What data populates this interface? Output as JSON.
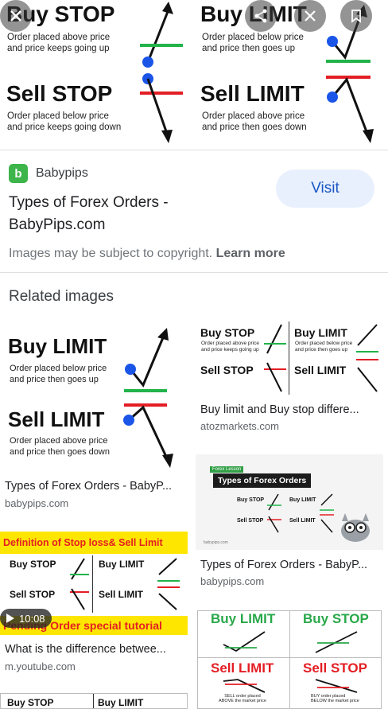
{
  "hero": {
    "left": {
      "top_title": "Buy STOP",
      "top_desc_1": "Order placed above price",
      "top_desc_2": "and price keeps going up",
      "bottom_title": "Sell STOP",
      "bottom_desc_1": "Order placed below price",
      "bottom_desc_2": "and price keeps going down"
    },
    "right": {
      "top_title": "Buy LIMIT",
      "top_desc_1": "Order placed below price",
      "top_desc_2": "and price then goes up",
      "bottom_title": "Sell LIMIT",
      "bottom_desc_1": "Order placed above price",
      "bottom_desc_2": "and price then goes down"
    },
    "buttons": {
      "close": "close-icon",
      "share": "share-icon",
      "save": "bookmark-icon"
    }
  },
  "source": {
    "favicon_letter": "b",
    "name": "Babypips",
    "title": "Types of Forex Orders - BabyPips.com",
    "visit_label": "Visit",
    "copyright_text": "Images may be subject to copyright.",
    "learn_more": "Learn more"
  },
  "related": {
    "heading": "Related images",
    "items": [
      {
        "caption": "Types of Forex Orders - BabyP...",
        "domain": "babypips.com",
        "thumb": {
          "t1": "Buy LIMIT",
          "d1a": "Order placed below price",
          "d1b": "and price then goes up",
          "t2": "Sell LIMIT",
          "d2a": "Order placed above price",
          "d2b": "and price then goes down"
        }
      },
      {
        "caption": "Buy limit and Buy stop differe...",
        "domain": "atozmarkets.com",
        "thumb": {
          "a": "Buy STOP",
          "b": "Buy LIMIT",
          "c": "Sell STOP",
          "d": "Sell LIMIT",
          "da": "Order placed above price",
          "db": "and price keeps going up",
          "dc": "Order placed below price",
          "dd": "and price then goes up"
        }
      },
      {
        "caption": "Types of Forex Orders - BabyP...",
        "domain": "babypips.com",
        "thumb": {
          "ribbon": "Forex Lesson",
          "banner": "Types of Forex Orders",
          "a": "Buy STOP",
          "b": "Buy LIMIT",
          "c": "Sell STOP",
          "d": "Sell LIMIT",
          "footer": "babypips.com"
        }
      },
      {
        "caption": "What is the difference betwee...",
        "domain": "m.youtube.com",
        "duration": "10:08",
        "thumb": {
          "top_banner": "Definition of Stop loss& Sell Limit",
          "a": "Buy STOP",
          "b": "Buy LIMIT",
          "c": "Sell STOP",
          "d": "Sell LIMIT",
          "bottom_banner": "Pending Order special tutorial"
        }
      },
      {
        "caption": "",
        "domain": "",
        "thumb": {
          "a": "Buy LIMIT",
          "b": "Buy STOP",
          "c": "Sell LIMIT",
          "d": "Sell STOP",
          "sa": "BUY order placed",
          "sb": "BELOW the market price",
          "sc": "SELL order placed",
          "sd": "ABOVE the market price"
        }
      },
      {
        "caption": "",
        "domain": "",
        "thumb": {
          "a": "Buy STOP",
          "b": "Buy LIMIT"
        }
      }
    ]
  },
  "colors": {
    "green": "#22b34a",
    "red": "#e31e24",
    "blue": "#1a55e8",
    "visit_bg": "#e8f0fe",
    "visit_text": "#1a56c4",
    "yellow": "#ffe600"
  }
}
